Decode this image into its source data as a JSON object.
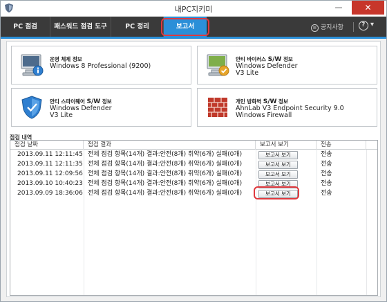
{
  "window": {
    "title": "내PC지키미",
    "minimize_glyph": "—",
    "close_glyph": "✕"
  },
  "tabs": [
    {
      "label": "PC 점검",
      "active": false
    },
    {
      "label": "패스워드 점검 도구",
      "active": false
    },
    {
      "label": "PC 정리",
      "active": false
    },
    {
      "label": "보고서",
      "active": true
    }
  ],
  "toolbar": {
    "notice_label": "공지사항",
    "notice_glyph": "≡",
    "help_glyph": "?",
    "help_arrow": "▾"
  },
  "cards": {
    "os": {
      "title": "운영 체제 정보",
      "value": "Windows 8 Professional (9200)"
    },
    "antivirus": {
      "title_prefix": "안티 바이러스 ",
      "title_sw": "S/W",
      "title_suffix": " 정보",
      "value_line1": "Windows Defender",
      "value_line2": "V3 Lite"
    },
    "antispyware": {
      "title_prefix": "안티 스파이웨어 ",
      "title_sw": "S/W",
      "title_suffix": " 정보",
      "value_line1": "Windows Defender",
      "value_line2": "V3 Lite"
    },
    "firewall": {
      "title_prefix": "개인 방화벽 ",
      "title_sw": "S/W",
      "title_suffix": " 정보",
      "value_line1": "AhnLab V3 Endpoint Security 9.0",
      "value_line2": "Windows Firewall"
    }
  },
  "history": {
    "section_label": "점검 내역",
    "columns": [
      "점검 날짜",
      "점검 결과",
      "보고서 보기",
      "전송"
    ],
    "rows": [
      {
        "date": "2013.09.11 12:11:45",
        "result": "전체 점검 항목(14개) 결과:안전(8개) 취약(6개) 실패(0개)",
        "button": "보고서 보기",
        "send": "전송"
      },
      {
        "date": "2013.09.11 12:11:35",
        "result": "전체 점검 항목(14개) 결과:안전(8개) 취약(6개) 실패(0개)",
        "button": "보고서 보기",
        "send": "전송"
      },
      {
        "date": "2013.09.11 12:09:56",
        "result": "전체 점검 항목(14개) 결과:안전(8개) 취약(6개) 실패(0개)",
        "button": "보고서 보기",
        "send": "전송"
      },
      {
        "date": "2013.09.10 10:40:23",
        "result": "전체 점검 항목(14개) 결과:안전(8개) 취약(6개) 실패(0개)",
        "button": "보고서 보기",
        "send": "전송"
      },
      {
        "date": "2013.09.09 18:36:06",
        "result": "전체 점검 항목(14개) 결과:안전(8개) 취약(6개) 실패(0개)",
        "button": "보고서 보기",
        "send": "전송"
      }
    ]
  },
  "colors": {
    "accent": "#2b8fd8",
    "highlight_ring": "#e0393e",
    "tabbar_bg": "#3a3a3a",
    "close_button": "#c7362b"
  }
}
